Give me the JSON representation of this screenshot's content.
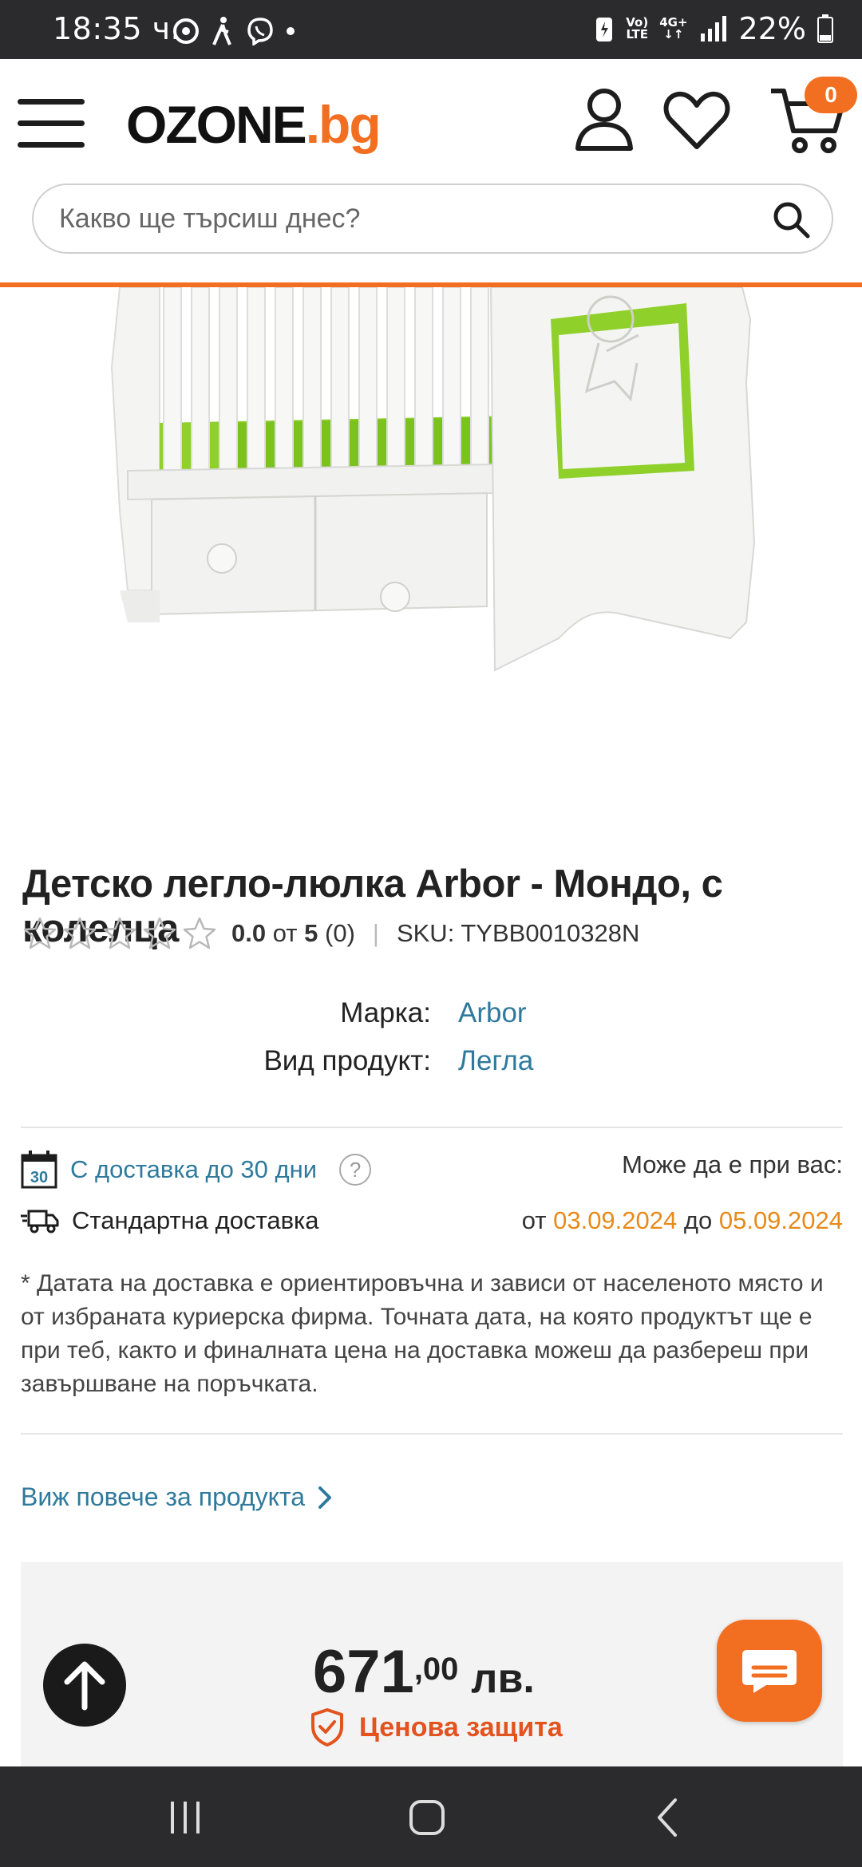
{
  "status_bar": {
    "time": "18:35 ч.",
    "network_top": "Vo)",
    "network_bottom": "LTE",
    "gen": "4G+",
    "battery": "22%"
  },
  "header": {
    "logo_main": "OZONE",
    "logo_tld": ".bg",
    "cart_count": "0",
    "search_placeholder": "Какво ще търсиш днес?"
  },
  "product": {
    "title": "Детско легло-люлка Arbor - Мондо, с колелца",
    "rating_value": "0.0",
    "rating_of": "от",
    "rating_max": "5",
    "rating_count": "(0)",
    "sku": "SKU: TYBB0010328N",
    "stars": 5
  },
  "specs": [
    {
      "key": "Марка:",
      "value": "Arbor"
    },
    {
      "key": "Вид продукт:",
      "value": "Легла"
    }
  ],
  "delivery": {
    "calendar_day": "30",
    "window_label": "С доставка до 30 дни",
    "help": "?",
    "may_be_with_you": "Може да е при вас:",
    "standard_label": "Стандартна доставка",
    "from_word": "от",
    "from_date": "03.09.2024",
    "to_word": "до",
    "to_date": "05.09.2024",
    "note": "* Датата на доставка е ориентировъчна и зависи от населеното място и от избраната куриерска фирма. Точната дата, на която продуктът ще е при теб, както и финалната цена на доставка можеш да разбереш при завършване на поръчката."
  },
  "more_link": "Виж повече за продукта",
  "price": {
    "whole": "671",
    "cents": ",00",
    "currency": "лв.",
    "protection": "Ценова защита"
  },
  "colors": {
    "accent": "#f26f21",
    "link": "#2f7a9c",
    "date": "#e88a1a"
  }
}
